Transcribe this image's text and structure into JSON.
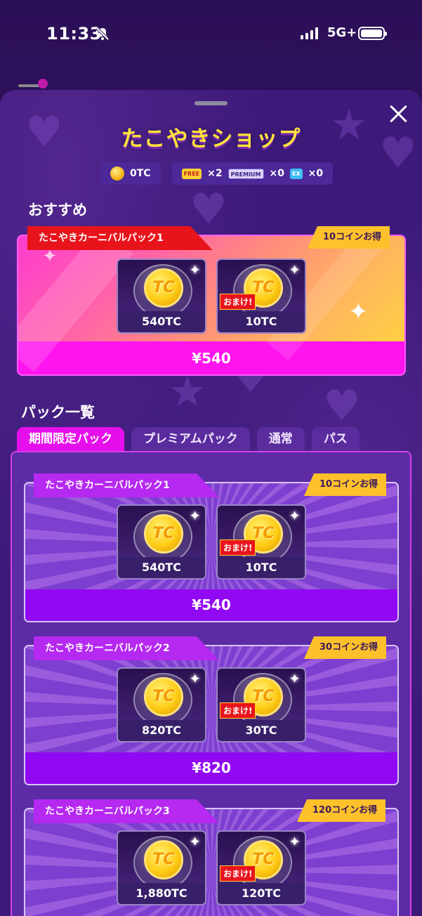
{
  "status_bar": {
    "time": "11:33",
    "network": "5G+"
  },
  "shop": {
    "title": "たこやきショップ",
    "balance": {
      "coins": "0TC",
      "free_tickets": "×2",
      "premium_tickets": "×0",
      "ex_tickets": "×0",
      "free_label": "FREE",
      "premium_label": "PREMIUM",
      "ex_label": "EX"
    }
  },
  "recommend": {
    "heading": "おすすめ",
    "pack": {
      "name": "たこやきカーニバルパック1",
      "badge": "10コインお得",
      "item1": "540TC",
      "item2": "10TC",
      "bonus": "おまけ!",
      "price": "¥540"
    }
  },
  "packs": {
    "heading": "パック一覧",
    "tabs": [
      "期間限定パック",
      "プレミアムパック",
      "通常",
      "パス"
    ],
    "items": [
      {
        "name": "たこやきカーニバルパック1",
        "badge": "10コインお得",
        "item1": "540TC",
        "item2": "10TC",
        "bonus": "おまけ!",
        "price": "¥540"
      },
      {
        "name": "たこやきカーニバルパック2",
        "badge": "30コインお得",
        "item1": "820TC",
        "item2": "30TC",
        "bonus": "おまけ!",
        "price": "¥820"
      },
      {
        "name": "たこやきカーニバルパック3",
        "badge": "120コインお得",
        "item1": "1,880TC",
        "item2": "120TC",
        "bonus": "おまけ!",
        "price": ""
      }
    ]
  },
  "icons": {
    "coin": "TC"
  },
  "colors": {
    "accent": "#e60fec",
    "title": "#ffe43a",
    "ribbon_red": "#e8141c",
    "badge": "#ffc12b",
    "price_bar": "#9109f2"
  }
}
